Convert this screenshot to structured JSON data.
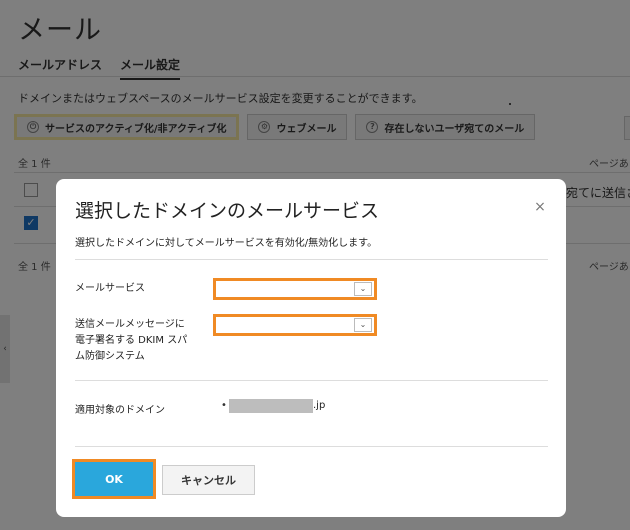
{
  "page": {
    "title": "メール",
    "tabs": [
      {
        "label": "メールアドレス",
        "active": false
      },
      {
        "label": "メール設定",
        "active": true
      }
    ],
    "description": "ドメインまたはウェブスペースのメールサービス設定を変更することができます。",
    "toolbar": {
      "activate_label": "サービスのアクティブ化/非アクティブ化",
      "webmail_label": "ウェブメール",
      "nonexistent_label": "存在しないユーザ宛てのメール"
    },
    "count_label": "全 1 件",
    "page_info": "ページあ",
    "column_text": "宛てに送信さ",
    "side_tab_label": "‹"
  },
  "modal": {
    "title": "選択したドメインのメールサービス",
    "close_label": "×",
    "description": "選択したドメインに対してメールサービスを有効化/無効化します。",
    "fields": {
      "mail_service_label": "メールサービス",
      "dkim_label_lines": [
        "送信メールメッセージに",
        "電子署名する DKIM スパ",
        "ム防御システム"
      ],
      "mail_service_value": "",
      "dkim_value": "",
      "select_arrow": "⌄"
    },
    "domain": {
      "label": "適用対象のドメイン",
      "bullet": "•",
      "suffix": ".jp"
    },
    "buttons": {
      "ok": "OK",
      "cancel": "キャンセル"
    }
  },
  "colors": {
    "accent_orange": "#f08a24",
    "ok_blue": "#2aa7dc",
    "highlight_yellow": "#f7e9a3",
    "checkbox_blue": "#1e73c8"
  },
  "icons": {
    "activate": "power-icon",
    "webmail": "gear-icon",
    "nonexistent": "question-icon",
    "close": "close-icon",
    "select": "chevron-down-icon",
    "check": "checkmark-icon"
  }
}
